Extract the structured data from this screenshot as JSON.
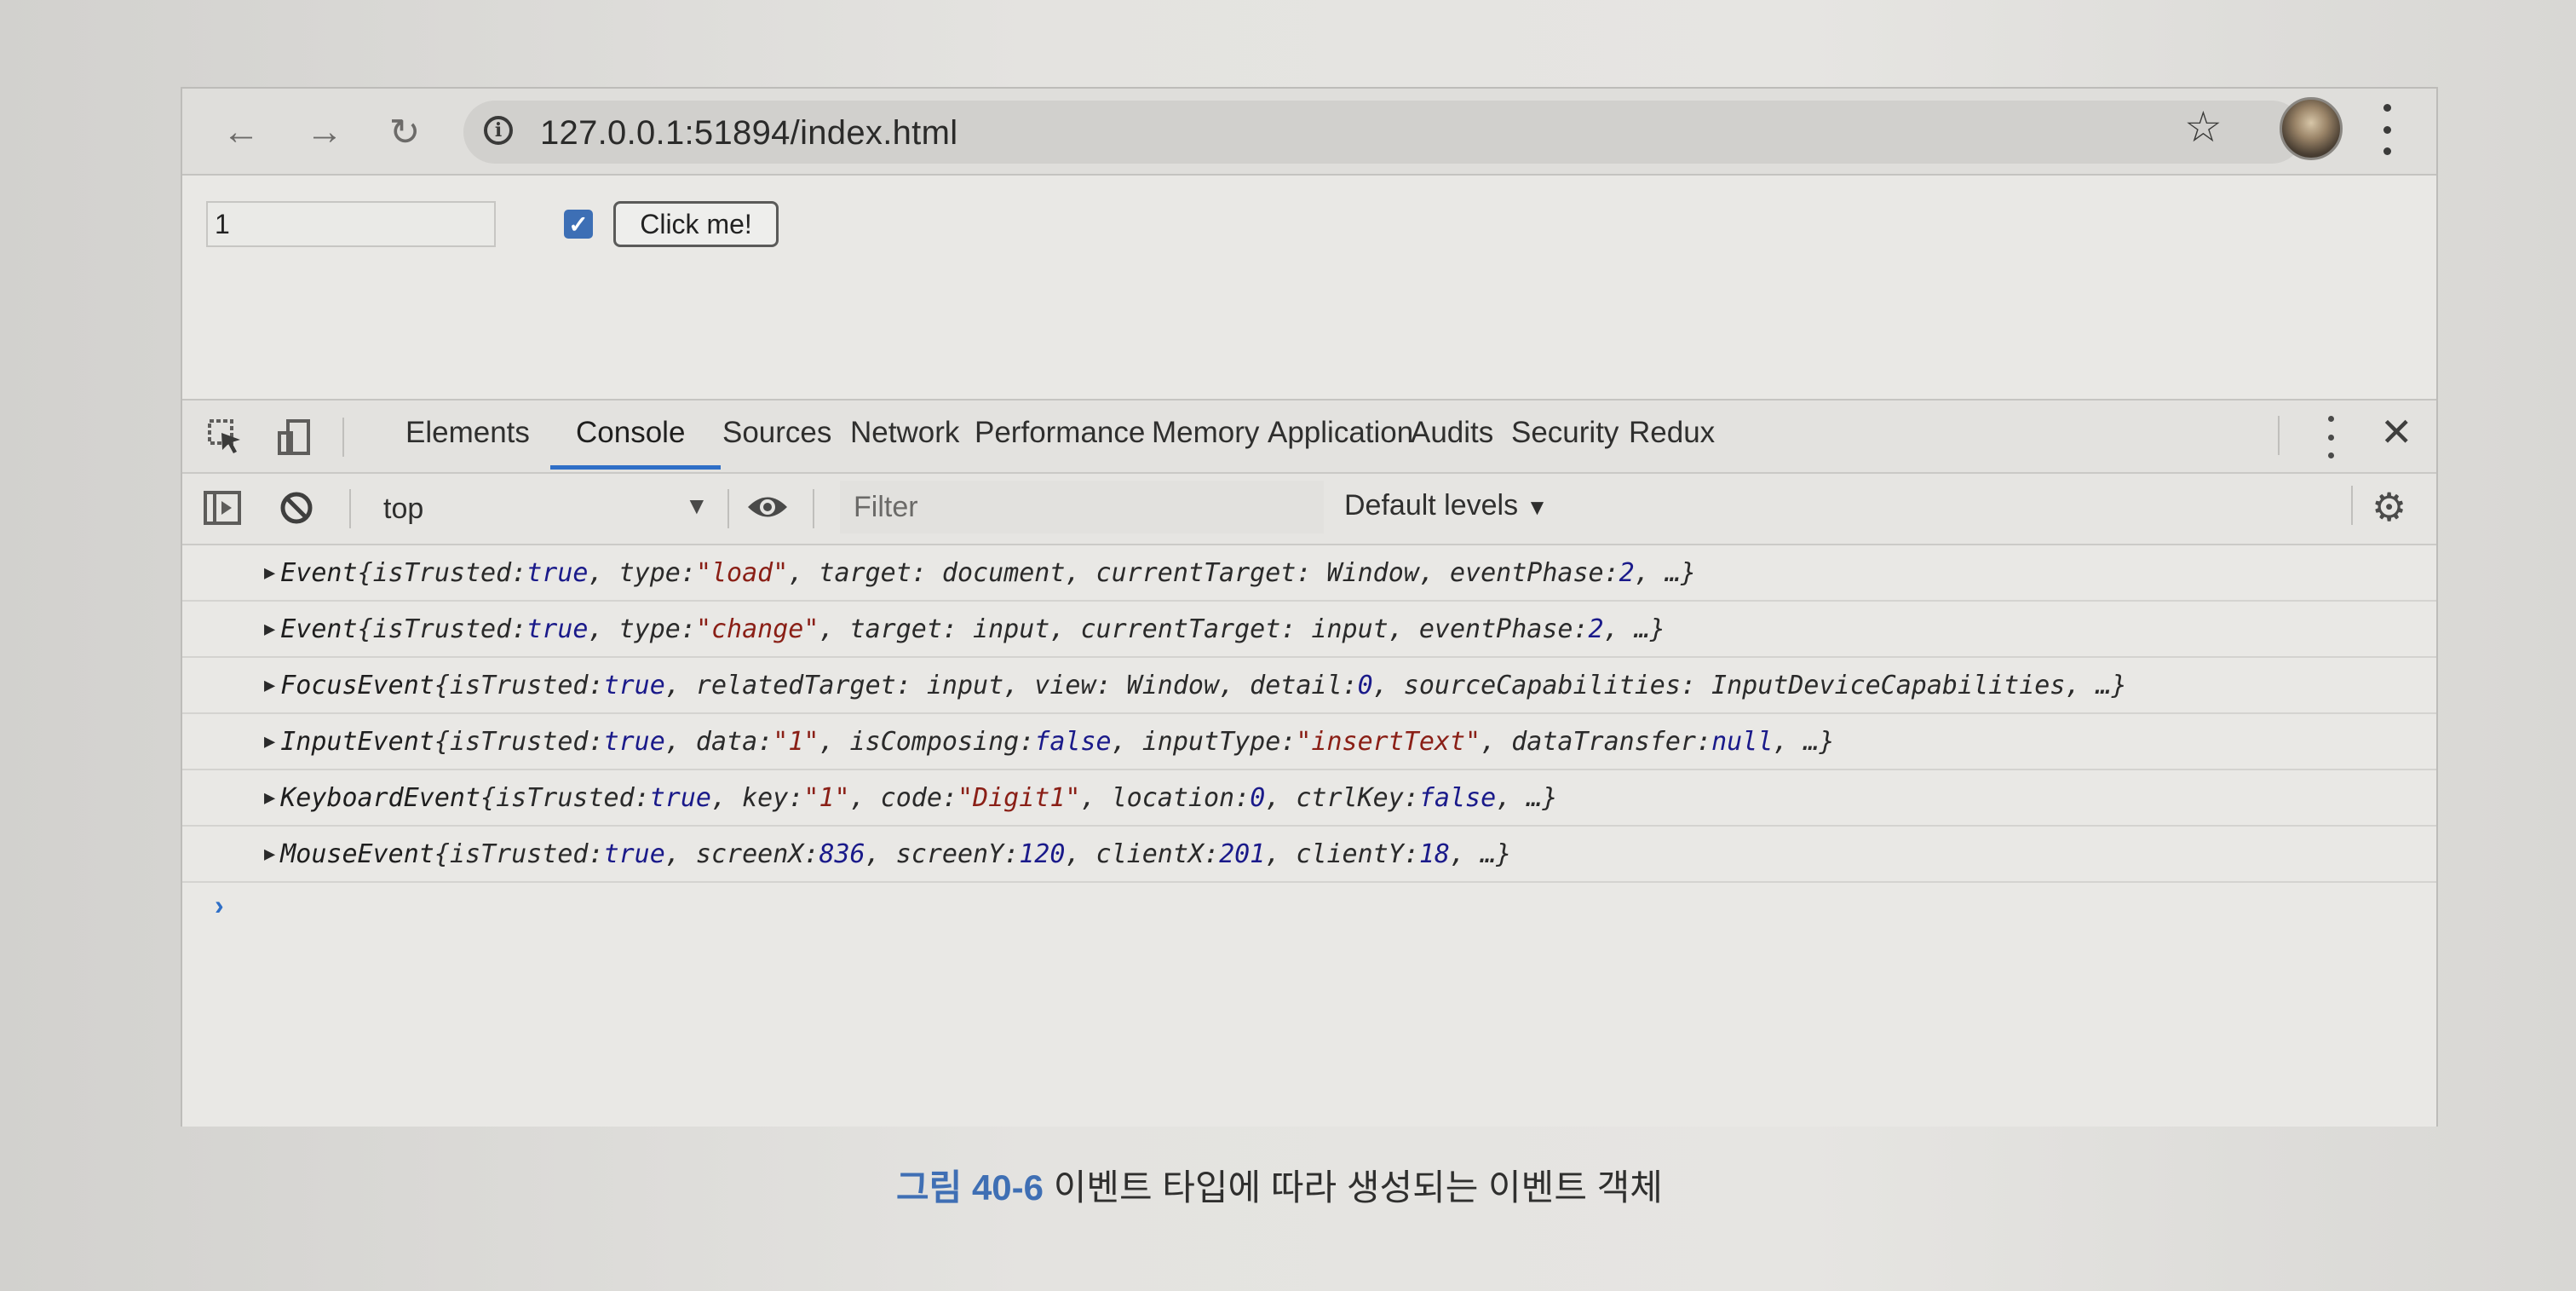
{
  "browser": {
    "url": "127.0.0.1:51894/index.html",
    "icons": [
      "back-icon",
      "forward-icon",
      "reload-icon",
      "info-icon",
      "star-icon",
      "avatar",
      "more-icon"
    ]
  },
  "page": {
    "input_value": "1",
    "checkbox_checked": true,
    "button_label": "Click me!"
  },
  "devtools": {
    "tabs": [
      "Elements",
      "Console",
      "Sources",
      "Network",
      "Performance",
      "Memory",
      "Application",
      "Audits",
      "Security",
      "Redux"
    ],
    "active_tab": "Console",
    "context": "top",
    "filter_placeholder": "Filter",
    "levels": "Default levels",
    "accent_color": "#2f6fc7",
    "logs": [
      {
        "type": "Event",
        "parts": [
          [
            "k",
            "{isTrusted: "
          ],
          [
            "kw",
            "true"
          ],
          [
            "k",
            ", type: "
          ],
          [
            "str",
            "\"load\""
          ],
          [
            "k",
            ", target: document, currentTarget: Window, eventPhase: "
          ],
          [
            "num",
            "2"
          ],
          [
            "k",
            ", …}"
          ]
        ]
      },
      {
        "type": "Event",
        "parts": [
          [
            "k",
            "{isTrusted: "
          ],
          [
            "kw",
            "true"
          ],
          [
            "k",
            ", type: "
          ],
          [
            "str",
            "\"change\""
          ],
          [
            "k",
            ", target: input, currentTarget: input, eventPhase: "
          ],
          [
            "num",
            "2"
          ],
          [
            "k",
            ", …}"
          ]
        ]
      },
      {
        "type": "FocusEvent",
        "parts": [
          [
            "k",
            "{isTrusted: "
          ],
          [
            "kw",
            "true"
          ],
          [
            "k",
            ", relatedTarget: input, view: Window, detail: "
          ],
          [
            "num",
            "0"
          ],
          [
            "k",
            ", sourceCapabilities: InputDeviceCapabilities, …}"
          ]
        ]
      },
      {
        "type": "InputEvent",
        "parts": [
          [
            "k",
            "{isTrusted: "
          ],
          [
            "kw",
            "true"
          ],
          [
            "k",
            ", data: "
          ],
          [
            "str",
            "\"1\""
          ],
          [
            "k",
            ", isComposing: "
          ],
          [
            "kw",
            "false"
          ],
          [
            "k",
            ", inputType: "
          ],
          [
            "str",
            "\"insertText\""
          ],
          [
            "k",
            ", dataTransfer: "
          ],
          [
            "kw",
            "null"
          ],
          [
            "k",
            ", …}"
          ]
        ]
      },
      {
        "type": "KeyboardEvent",
        "parts": [
          [
            "k",
            "{isTrusted: "
          ],
          [
            "kw",
            "true"
          ],
          [
            "k",
            ", key: "
          ],
          [
            "str",
            "\"1\""
          ],
          [
            "k",
            ", code: "
          ],
          [
            "str",
            "\"Digit1\""
          ],
          [
            "k",
            ", location: "
          ],
          [
            "num",
            "0"
          ],
          [
            "k",
            ", ctrlKey: "
          ],
          [
            "kw",
            "false"
          ],
          [
            "k",
            ", …}"
          ]
        ]
      },
      {
        "type": "MouseEvent",
        "parts": [
          [
            "k",
            "{isTrusted: "
          ],
          [
            "kw",
            "true"
          ],
          [
            "k",
            ", screenX: "
          ],
          [
            "num",
            "836"
          ],
          [
            "k",
            ", screenY: "
          ],
          [
            "num",
            "120"
          ],
          [
            "k",
            ", clientX: "
          ],
          [
            "num",
            "201"
          ],
          [
            "k",
            ", clientY: "
          ],
          [
            "num",
            "18"
          ],
          [
            "k",
            ", …}"
          ]
        ]
      }
    ]
  },
  "caption": {
    "figure": "그림 40-6",
    "text": "이벤트 타입에 따라 생성되는 이벤트 객체"
  }
}
